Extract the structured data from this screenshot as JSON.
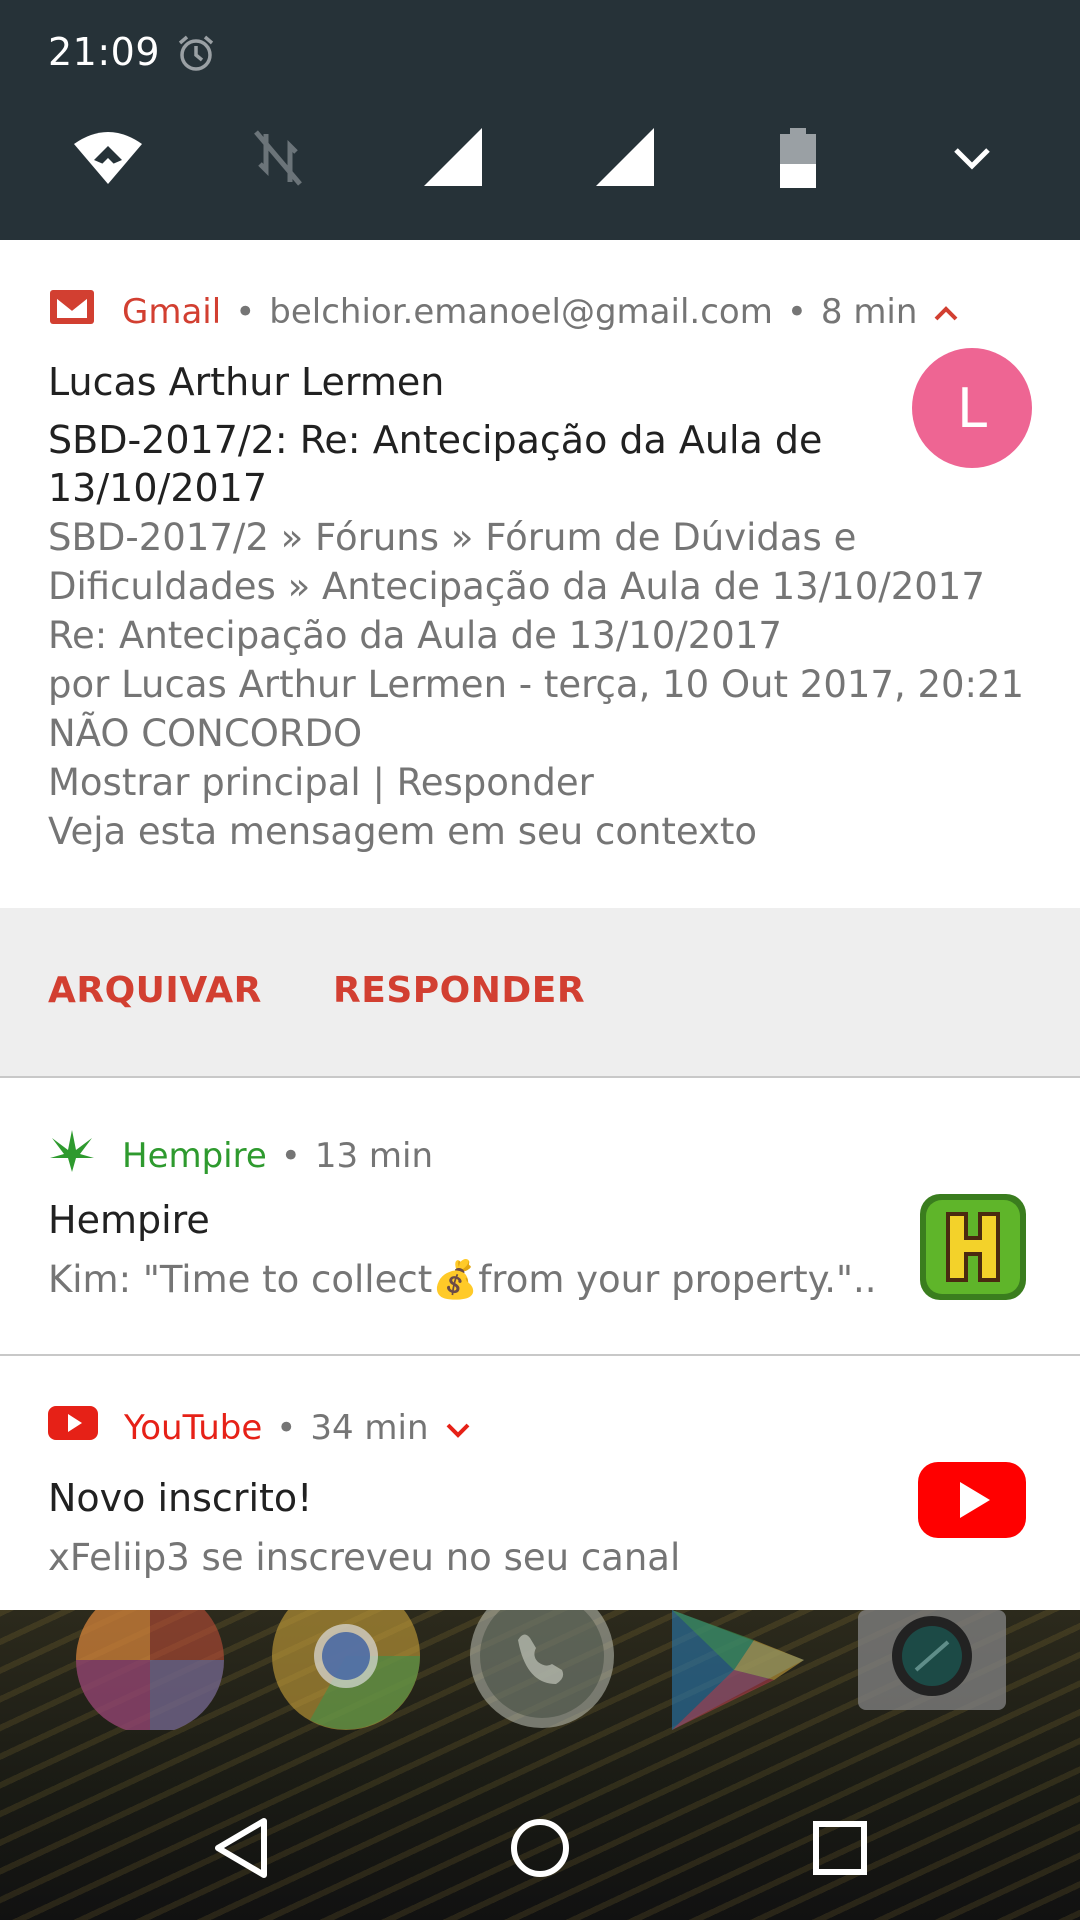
{
  "status_bar": {
    "time": "21:09",
    "icons": [
      "alarm-icon",
      "wifi-icon",
      "data-off-icon",
      "signal-icon",
      "signal-icon",
      "battery-icon",
      "chevron-down-icon"
    ]
  },
  "gmail": {
    "app_name": "Gmail",
    "account": "belchior.emanoel@gmail.com",
    "time": "8 min",
    "sender": "Lucas Arthur Lermen",
    "subject_line1": "SBD-2017/2: Re: Antecipação da Aula de",
    "subject_line2": "13/10/2017",
    "body_lines": [
      "SBD-2017/2 » Fóruns » Fórum de Dúvidas e",
      "Dificuldades » Antecipação da Aula de 13/10/2017",
      "Re: Antecipação da Aula de 13/10/2017",
      "por Lucas Arthur Lermen - terça, 10 Out 2017, 20:21",
      "NÃO CONCORDO",
      "Mostrar principal | Responder",
      "Veja esta mensagem em seu contexto"
    ],
    "avatar_letter": "L",
    "avatar_color": "#ee6593",
    "accent": "#d23f31",
    "actions": {
      "archive": "ARQUIVAR",
      "reply": "RESPONDER"
    }
  },
  "hempire": {
    "app_name": "Hempire",
    "time": "13 min",
    "title": "Hempire",
    "text": "Kim: \"Time to collect💰from your property.\"..",
    "accent": "#2e9a2e"
  },
  "youtube": {
    "app_name": "YouTube",
    "time": "34 min",
    "title": "Novo inscrito!",
    "text": "xFeliip3 se inscreveu no seu canal",
    "accent": "#e62117"
  },
  "separator": "•",
  "dock": [
    "gallery-icon",
    "chrome-icon",
    "whatsapp-icon",
    "play-store-icon",
    "camera-icon"
  ],
  "nav": [
    "back-button",
    "home-button",
    "recents-button"
  ]
}
